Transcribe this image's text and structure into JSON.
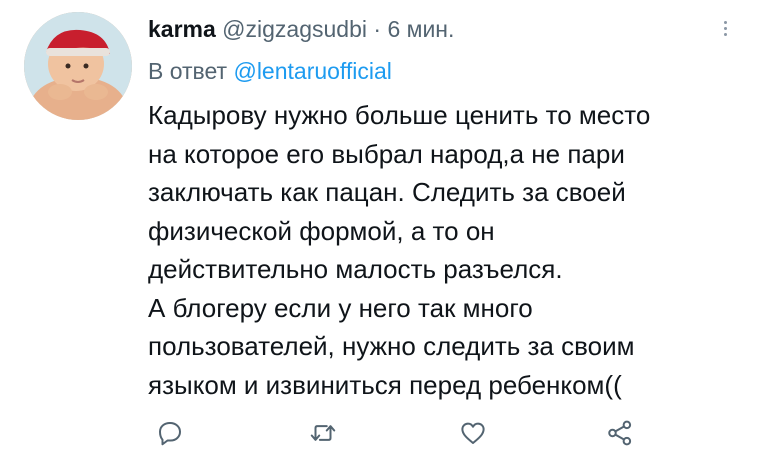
{
  "tweet": {
    "display_name": "karma",
    "handle": "@zigzagsudbi",
    "separator": "·",
    "time": "6 мин.",
    "reply_prefix": "В ответ",
    "reply_to": "@lentaruofficial",
    "body_lines": [
      "Кадырову нужно больше ценить то место",
      "на которое его выбрал народ,а не пари",
      "заключать как пацан. Следить за своей",
      "физической формой, а то он",
      "действительно малость разъелся.",
      "А блогеру если  у него так много",
      "пользователей, нужно следить за своим",
      "языком и извиниться перед ребенком(("
    ]
  },
  "icons": {
    "avatar": "baby-photo",
    "more": "more-vertical-icon",
    "reply": "reply-icon",
    "retweet": "retweet-icon",
    "like": "heart-icon",
    "share": "share-icon"
  },
  "colors": {
    "text": "#0f1419",
    "secondary": "#536471",
    "link": "#1d9bf0",
    "icon": "#536471"
  }
}
